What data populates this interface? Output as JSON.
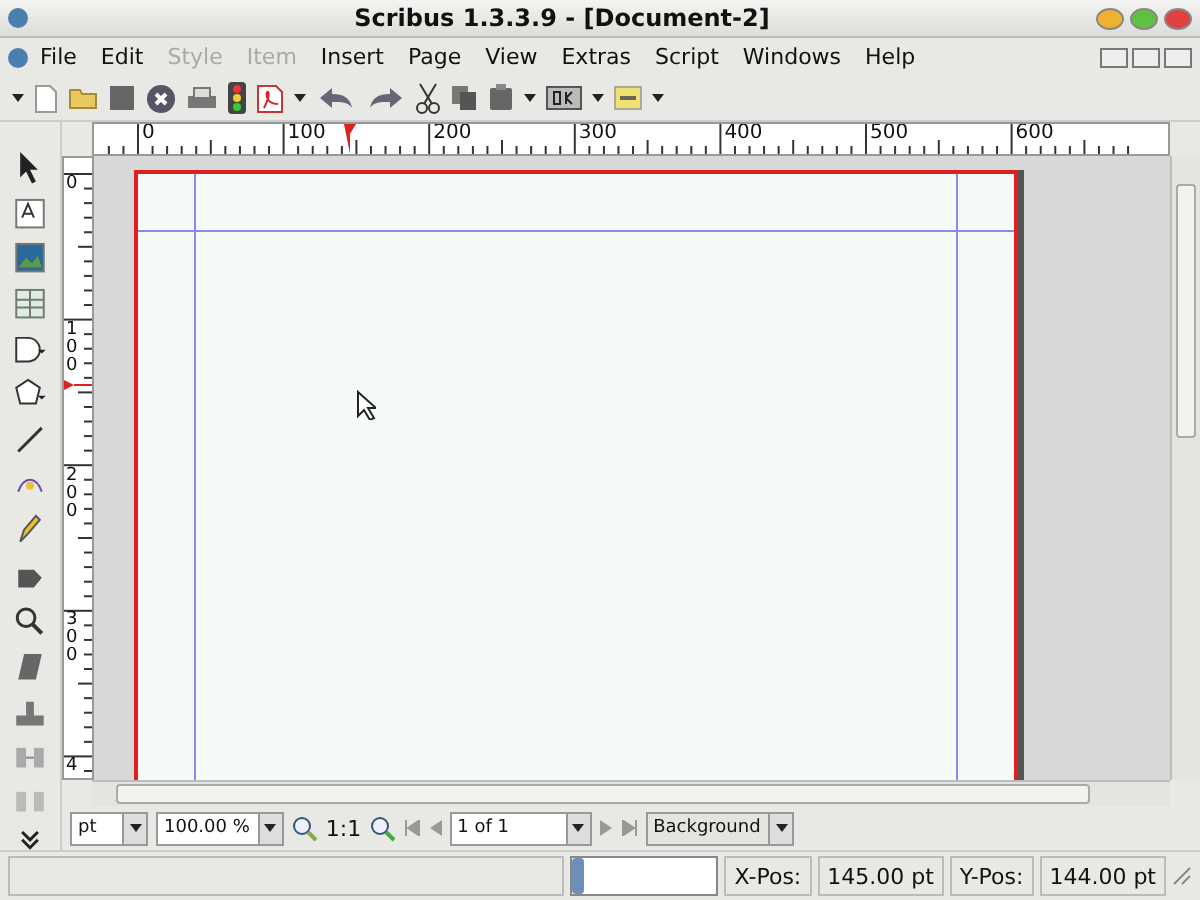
{
  "window": {
    "title": "Scribus 1.3.3.9 - [Document-2]"
  },
  "menu": [
    {
      "label": "File",
      "disabled": false
    },
    {
      "label": "Edit",
      "disabled": false
    },
    {
      "label": "Style",
      "disabled": true
    },
    {
      "label": "Item",
      "disabled": true
    },
    {
      "label": "Insert",
      "disabled": false
    },
    {
      "label": "Page",
      "disabled": false
    },
    {
      "label": "View",
      "disabled": false
    },
    {
      "label": "Extras",
      "disabled": false
    },
    {
      "label": "Script",
      "disabled": false
    },
    {
      "label": "Windows",
      "disabled": false
    },
    {
      "label": "Help",
      "disabled": false
    }
  ],
  "ruler": {
    "horizontal_labels": [
      "0",
      "100",
      "200",
      "300",
      "400",
      "500",
      "600"
    ],
    "vertical_labels": [
      "0",
      "100",
      "200",
      "300",
      "4"
    ]
  },
  "bottom_bar": {
    "unit": "pt",
    "zoom": "100.00 %",
    "actual_size": "1:1",
    "page": "1 of 1",
    "layer": "Background"
  },
  "status_bar": {
    "progress": {
      "level": 0.08
    },
    "x_label": "X-Pos:",
    "x_value": "145.00 pt",
    "y_label": "Y-Pos:",
    "y_value": "144.00 pt"
  }
}
